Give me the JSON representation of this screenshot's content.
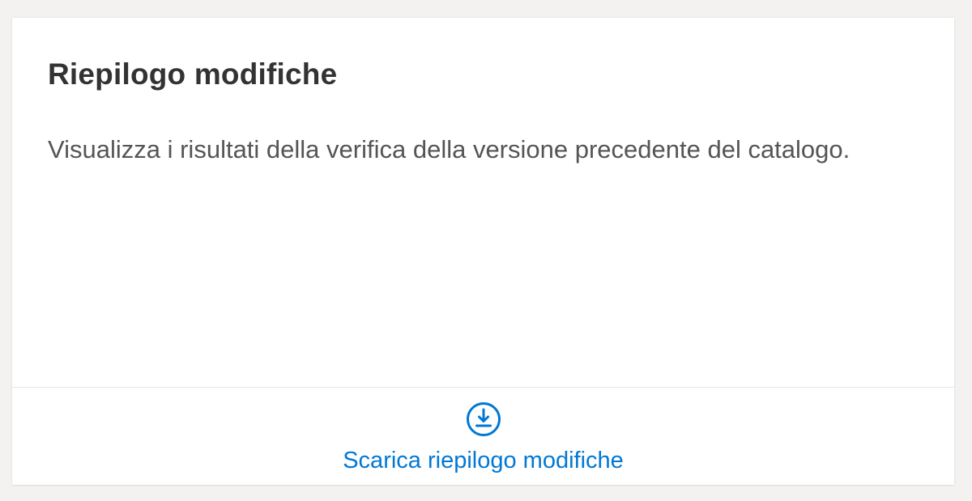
{
  "card": {
    "title": "Riepilogo modifiche",
    "description": "Visualizza i risultati della verifica della versione precedente del catalogo.",
    "action": {
      "icon": "download-circle-icon",
      "label": "Scarica riepilogo modifiche"
    }
  },
  "colors": {
    "background": "#f3f2f1",
    "card": "#ffffff",
    "title": "#333333",
    "text": "#555555",
    "accent": "#0078d4"
  }
}
